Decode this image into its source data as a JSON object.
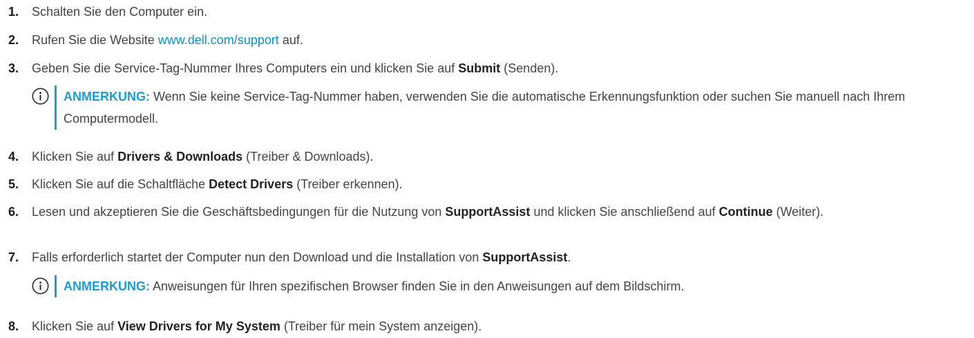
{
  "steps": [
    {
      "num": "1.",
      "text": "Schalten Sie den Computer ein."
    },
    {
      "num": "2.",
      "pre": "Rufen Sie die Website ",
      "link": "www.dell.com/support",
      "post": " auf."
    },
    {
      "num": "3.",
      "pre": "Geben Sie die Service-Tag-Nummer Ihres Computers ein und klicken Sie auf ",
      "bold": "Submit",
      "post": " (Senden)."
    },
    {
      "num": "4.",
      "pre": "Klicken Sie auf ",
      "bold": "Drivers & Downloads",
      "post": " (Treiber & Downloads)."
    },
    {
      "num": "5.",
      "pre": "Klicken Sie auf die Schaltfläche ",
      "bold": "Detect Drivers",
      "post": " (Treiber erkennen)."
    },
    {
      "num": "6.",
      "pre": "Lesen und akzeptieren Sie die Geschäftsbedingungen für die Nutzung von ",
      "bold": "SupportAssist",
      "mid": " und klicken Sie anschließend auf ",
      "bold2": "Continue",
      "post": " (Weiter)."
    },
    {
      "num": "7.",
      "pre": "Falls erforderlich startet der Computer nun den Download und die Installation von ",
      "bold": "SupportAssist",
      "post": "."
    },
    {
      "num": "8.",
      "pre": "Klicken Sie auf ",
      "bold": "View Drivers for My System",
      "post": " (Treiber für mein System anzeigen)."
    }
  ],
  "notes": [
    {
      "label": "ANMERKUNG:",
      "text": " Wenn Sie keine Service-Tag-Nummer haben, verwenden Sie die automatische Erkennungsfunktion oder suchen Sie manuell nach Ihrem Computermodell."
    },
    {
      "label": "ANMERKUNG:",
      "text": " Anweisungen für Ihren spezifischen Browser finden Sie in den Anweisungen auf dem Bildschirm."
    }
  ],
  "icon": "info-icon",
  "colors": {
    "accent": "#1b9bd8",
    "link": "#0b8fd1",
    "text": "#444444"
  }
}
